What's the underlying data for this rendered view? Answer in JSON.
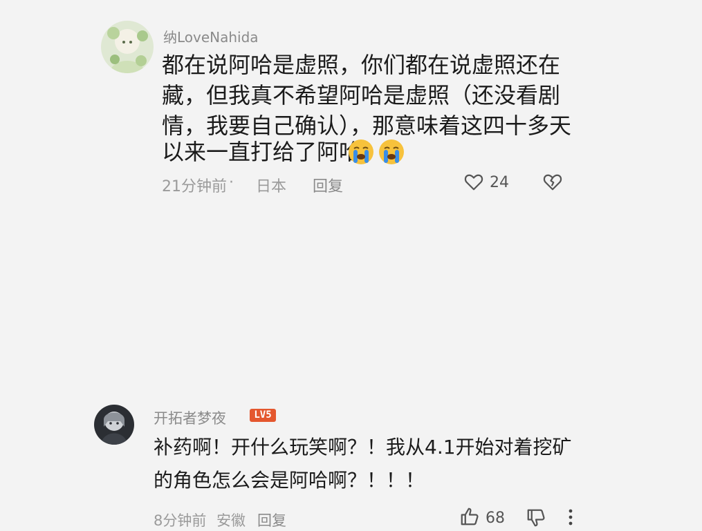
{
  "comments": [
    {
      "username": "纳LoveNahida",
      "text_lines": [
        "都在说阿哈是虚照，你们都在说虚照还在",
        "藏，但我真不希望阿哈是虚照（还没看剧",
        "情，我要自己确认），那意味着这四十多天",
        "以来一直打给了阿哈"
      ],
      "emoji": [
        "crying-face",
        "crying-face"
      ],
      "time": "21分钟前",
      "separator": "·",
      "location": "日本",
      "reply_label": "回复",
      "like_count": "24",
      "icons": [
        "heart-outline-icon",
        "broken-heart-icon"
      ]
    },
    {
      "username": "开拓者梦夜",
      "level": "LV5",
      "text_lines": [
        "补药啊！开什么玩笑啊？！我从4.1开始对着挖矿",
        "的角色怎么会是阿哈啊？！！！"
      ],
      "time": "8分钟前",
      "location": "安徽",
      "reply_label": "回复",
      "like_count": "68",
      "icons": [
        "thumbs-up-icon",
        "thumbs-down-icon",
        "more-vertical-icon"
      ]
    }
  ],
  "colors": {
    "background": "#f3f3f3",
    "text_primary": "#1b1b1b",
    "text_secondary": "#9a9a9a",
    "level_badge": "#e4572e",
    "emoji_face": "#f7c23c",
    "emoji_tears": "#3a8ee6"
  }
}
